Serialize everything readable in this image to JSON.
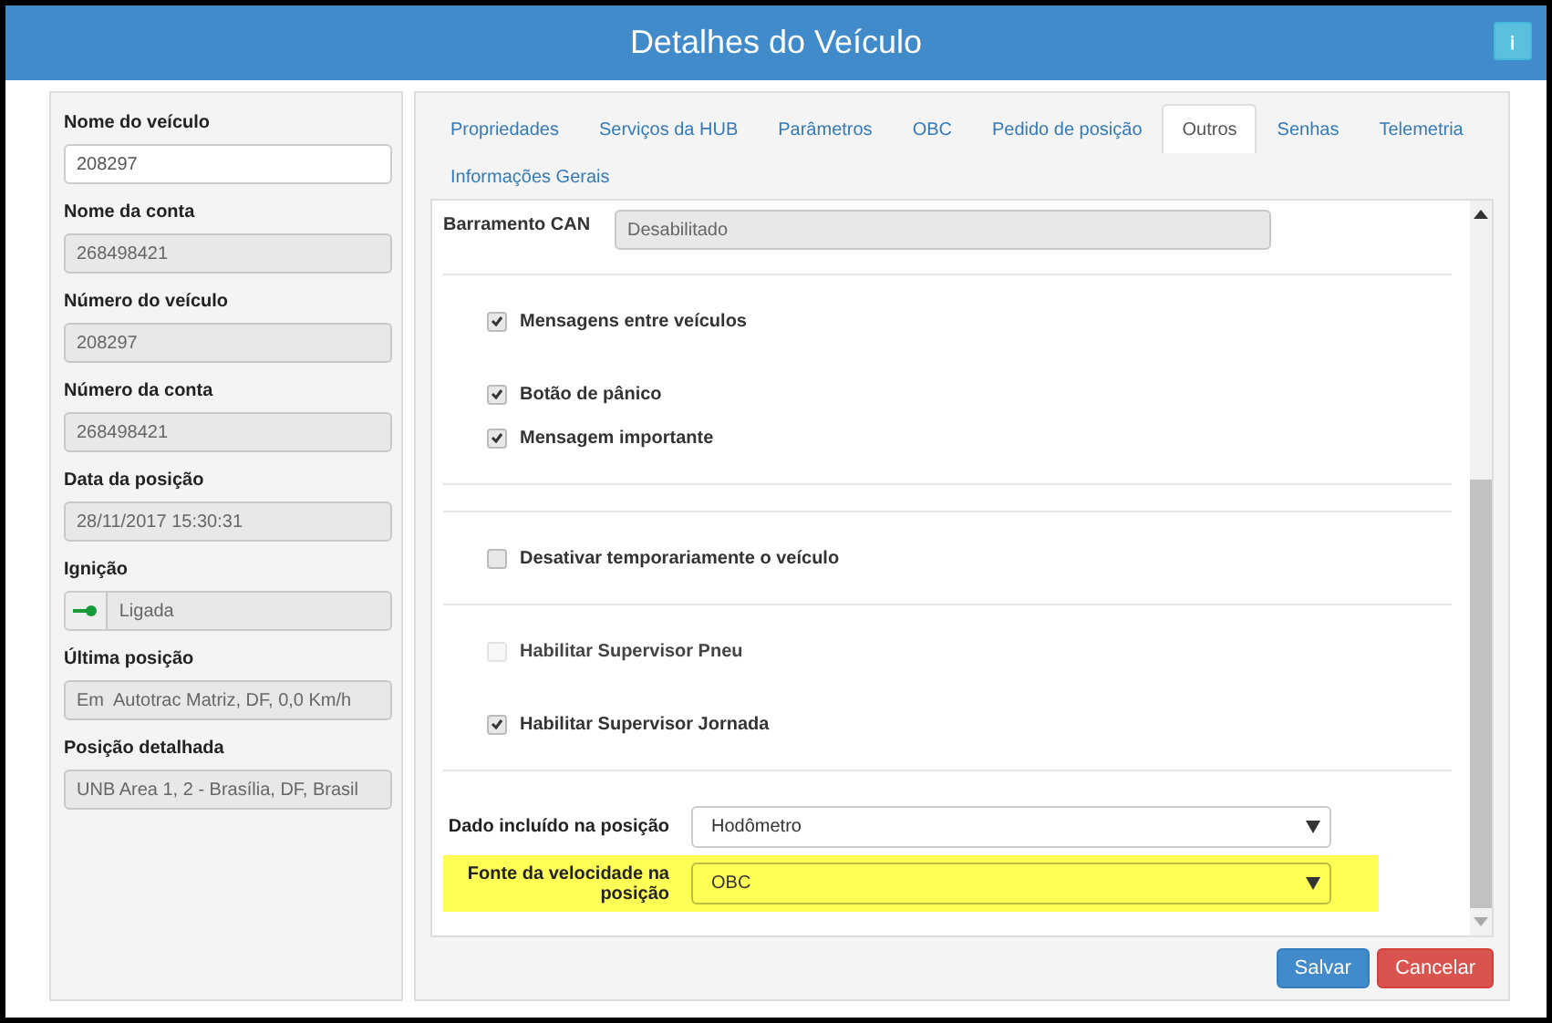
{
  "window": {
    "title": "Detalhes do Veículo",
    "info_button": "ℹ"
  },
  "vehicle_panel": {
    "fields": [
      {
        "label": "Nome do veículo",
        "value": "208297",
        "disabled": false
      },
      {
        "label": "Nome da conta",
        "value": "268498421",
        "disabled": true
      },
      {
        "label": "Número do veículo",
        "value": "208297",
        "disabled": true
      },
      {
        "label": "Número da conta",
        "value": "268498421",
        "disabled": true
      },
      {
        "label": "Data da posição",
        "value": "28/11/2017 15:30:31",
        "disabled": true
      },
      {
        "label": "Ignição",
        "value": "Ligada",
        "disabled": true,
        "kind": "ignition"
      },
      {
        "label": "Última posição",
        "value": "Em  Autotrac Matriz, DF, 0,0 Km/h",
        "disabled": true
      },
      {
        "label": "Posição detalhada",
        "value": "UNB Area 1, 2 - Brasília, DF, Brasil",
        "disabled": true
      }
    ]
  },
  "tabs": [
    {
      "label": "Propriedades",
      "selected": false
    },
    {
      "label": "Serviços da HUB",
      "selected": false
    },
    {
      "label": "Parâmetros",
      "selected": false
    },
    {
      "label": "OBC",
      "selected": false
    },
    {
      "label": "Pedido de posição",
      "selected": false
    },
    {
      "label": "Outros",
      "selected": true
    },
    {
      "label": "Senhas",
      "selected": false
    },
    {
      "label": "Telemetria",
      "selected": false
    },
    {
      "label": "Informações Gerais",
      "selected": false
    }
  ],
  "sections": [
    {
      "groups": [
        [
          {
            "kind": "field",
            "label": "Barramento CAN",
            "value": "Desabilitado"
          }
        ]
      ]
    },
    {
      "groups": [
        [
          {
            "kind": "checkbox",
            "label": "Mensagens entre veículos",
            "checked": true,
            "disabled": false
          }
        ],
        [
          {
            "kind": "checkbox",
            "label": "Botão de pânico",
            "checked": true,
            "disabled": false
          },
          {
            "kind": "checkbox",
            "label": "Mensagem importante",
            "checked": true,
            "disabled": false
          }
        ]
      ]
    },
    {
      "groups": [
        [
          {
            "kind": "checkbox",
            "label": "Desativar temporariamente o veículo",
            "checked": false,
            "disabled": false
          }
        ]
      ]
    },
    {
      "groups": [
        [
          {
            "kind": "checkbox",
            "label": "Habilitar Supervisor Pneu",
            "checked": false,
            "disabled": true
          }
        ],
        [
          {
            "kind": "checkbox",
            "label": "Habilitar Supervisor Jornada",
            "checked": true,
            "disabled": false
          }
        ]
      ]
    },
    {
      "groups": [
        [
          {
            "kind": "select",
            "label": "Dado incluído na posição",
            "value": "Hodômetro",
            "highlighted": false
          },
          {
            "kind": "select",
            "label": "Fonte da velocidade na posição",
            "value": "OBC",
            "highlighted": true
          }
        ]
      ]
    }
  ],
  "buttons": [
    {
      "label": "Salvar",
      "kind": "primary"
    },
    {
      "label": "Cancelar",
      "kind": "danger"
    }
  ]
}
